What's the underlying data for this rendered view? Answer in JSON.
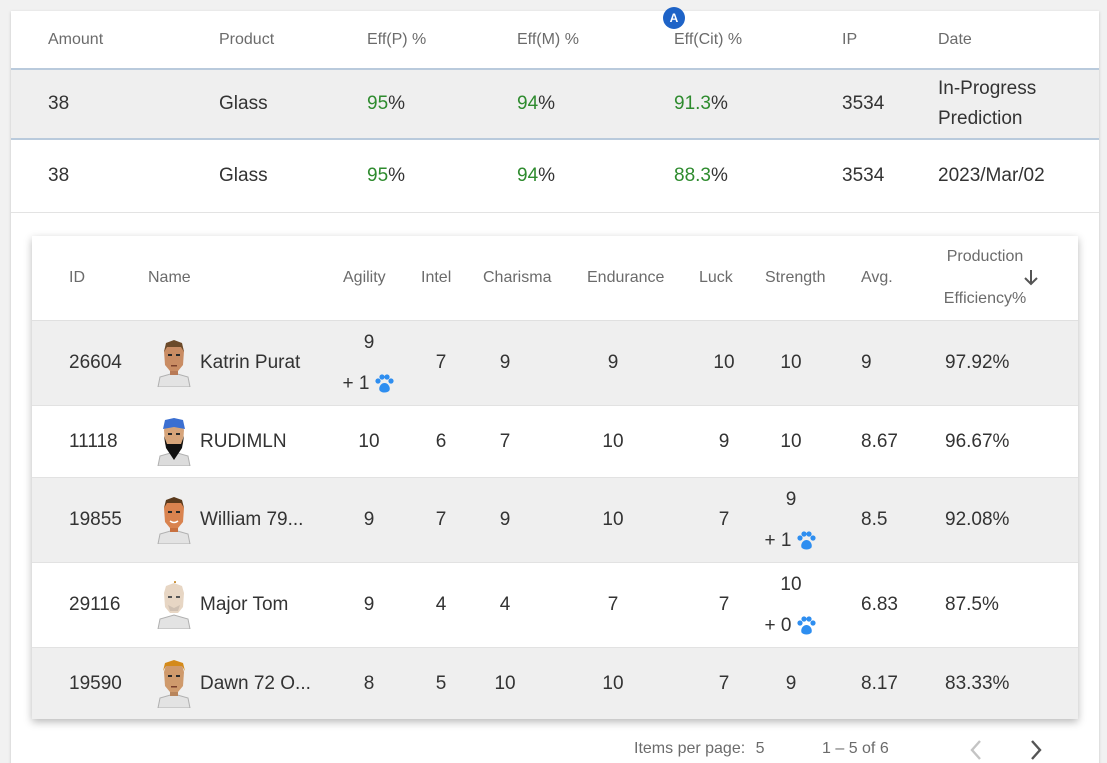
{
  "badge": "A",
  "top_table": {
    "headers": {
      "amount": "Amount",
      "product": "Product",
      "effp": "Eff(P) %",
      "effm": "Eff(M) %",
      "effc": "Eff(Cit) %",
      "ip": "IP",
      "date": "Date"
    },
    "rows": [
      {
        "amount": "38",
        "product": "Glass",
        "effp": "95",
        "effm": "94",
        "effc": "91.3",
        "ip": "3534",
        "date_line1": "In-Progress",
        "date_line2": "Prediction",
        "highlighted": true
      },
      {
        "amount": "38",
        "product": "Glass",
        "effp": "95",
        "effm": "94",
        "effc": "88.3",
        "ip": "3534",
        "date": "2023/Mar/02",
        "highlighted": false
      }
    ],
    "percent_sign": "%"
  },
  "citizens_table": {
    "headers": {
      "id": "ID",
      "name": "Name",
      "agility": "Agility",
      "intel": "Intel",
      "charisma": "Charisma",
      "endurance": "Endurance",
      "luck": "Luck",
      "strength": "Strength",
      "avg": "Avg.",
      "prod_line1": "Production",
      "prod_line2": "Efficiency%"
    },
    "rows": [
      {
        "id": "26604",
        "name": "Katrin Purat",
        "agility": "9",
        "agility_bonus": "+ 1",
        "intel": "7",
        "charisma": "9",
        "endurance": "9",
        "luck": "10",
        "strength": "10",
        "avg": "9",
        "eff": "97.92%"
      },
      {
        "id": "11118",
        "name": "RUDIMLN",
        "agility": "10",
        "intel": "6",
        "charisma": "7",
        "endurance": "10",
        "luck": "9",
        "strength": "10",
        "avg": "8.67",
        "eff": "96.67%"
      },
      {
        "id": "19855",
        "name": "William 79...",
        "agility": "9",
        "intel": "7",
        "charisma": "9",
        "endurance": "10",
        "luck": "7",
        "strength": "9",
        "strength_bonus": "+ 1",
        "avg": "8.5",
        "eff": "92.08%"
      },
      {
        "id": "29116",
        "name": "Major Tom",
        "agility": "9",
        "intel": "4",
        "charisma": "4",
        "endurance": "7",
        "luck": "7",
        "strength": "10",
        "strength_bonus": "+ 0",
        "avg": "6.83",
        "eff": "87.5%"
      },
      {
        "id": "19590",
        "name": "Dawn 72 O...",
        "agility": "8",
        "intel": "5",
        "charisma": "10",
        "endurance": "10",
        "luck": "7",
        "strength": "9",
        "avg": "8.17",
        "eff": "83.33%"
      }
    ]
  },
  "paginator": {
    "items_per_page_label": "Items per page:",
    "items_per_page_value": "5",
    "range": "1 – 5 of 6"
  },
  "colors": {
    "green": "#2e8b2e",
    "blue_link": "#2e6fb5",
    "paw": "#2e8ef0",
    "badge": "#1e63c7"
  }
}
